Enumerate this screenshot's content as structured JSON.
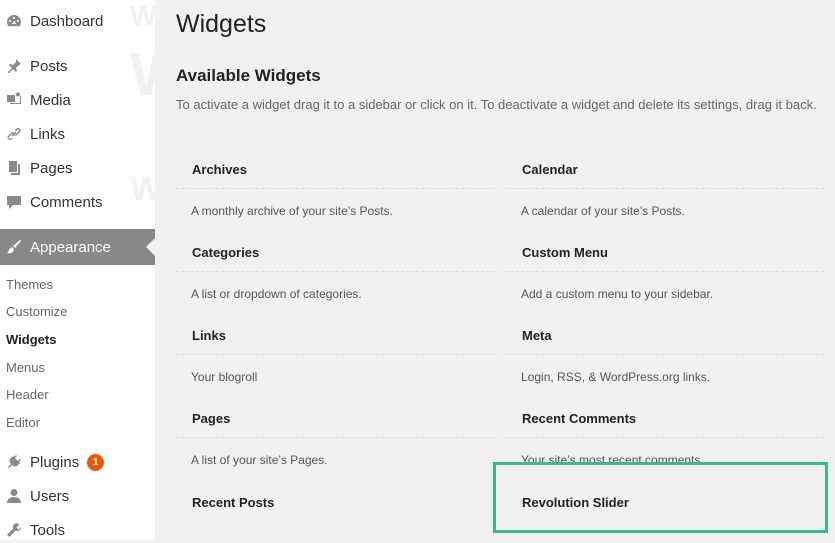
{
  "sidebar": {
    "watermark_text": "W",
    "items": [
      {
        "label": "Dashboard",
        "icon": "dashboard-icon"
      },
      {
        "label": "Posts",
        "icon": "pushpin-icon"
      },
      {
        "label": "Media",
        "icon": "media-icon"
      },
      {
        "label": "Links",
        "icon": "link-icon"
      },
      {
        "label": "Pages",
        "icon": "pages-icon"
      },
      {
        "label": "Comments",
        "icon": "comment-icon"
      },
      {
        "label": "Appearance",
        "icon": "paintbrush-icon"
      },
      {
        "label": "Plugins",
        "icon": "plug-icon",
        "badge": "1"
      },
      {
        "label": "Users",
        "icon": "user-icon"
      },
      {
        "label": "Tools",
        "icon": "wrench-icon"
      }
    ],
    "submenu": [
      "Themes",
      "Customize",
      "Widgets",
      "Menus",
      "Header",
      "Editor"
    ],
    "current_submenu": "Widgets",
    "active_bg": "#888888",
    "badge_color": "#e8590c"
  },
  "main": {
    "title": "Widgets",
    "section_title": "Available Widgets",
    "description": "To activate a widget drag it to a sidebar or click on it. To deactivate a widget and delete its settings, drag it back.",
    "widgets": [
      {
        "title": "Archives",
        "desc": "A monthly archive of your site’s Posts."
      },
      {
        "title": "Calendar",
        "desc": "A calendar of your site’s Posts."
      },
      {
        "title": "Categories",
        "desc": "A list or dropdown of categories."
      },
      {
        "title": "Custom Menu",
        "desc": "Add a custom menu to your sidebar."
      },
      {
        "title": "Links",
        "desc": "Your blogroll"
      },
      {
        "title": "Meta",
        "desc": "Login, RSS, & WordPress.org links."
      },
      {
        "title": "Pages",
        "desc": "A list of your site’s Pages."
      },
      {
        "title": "Recent Comments",
        "desc": "Your site’s most recent comments."
      },
      {
        "title": "Recent Posts",
        "desc": ""
      },
      {
        "title": "Revolution Slider",
        "desc": ""
      }
    ],
    "highlight_color": "#3cb88e"
  }
}
